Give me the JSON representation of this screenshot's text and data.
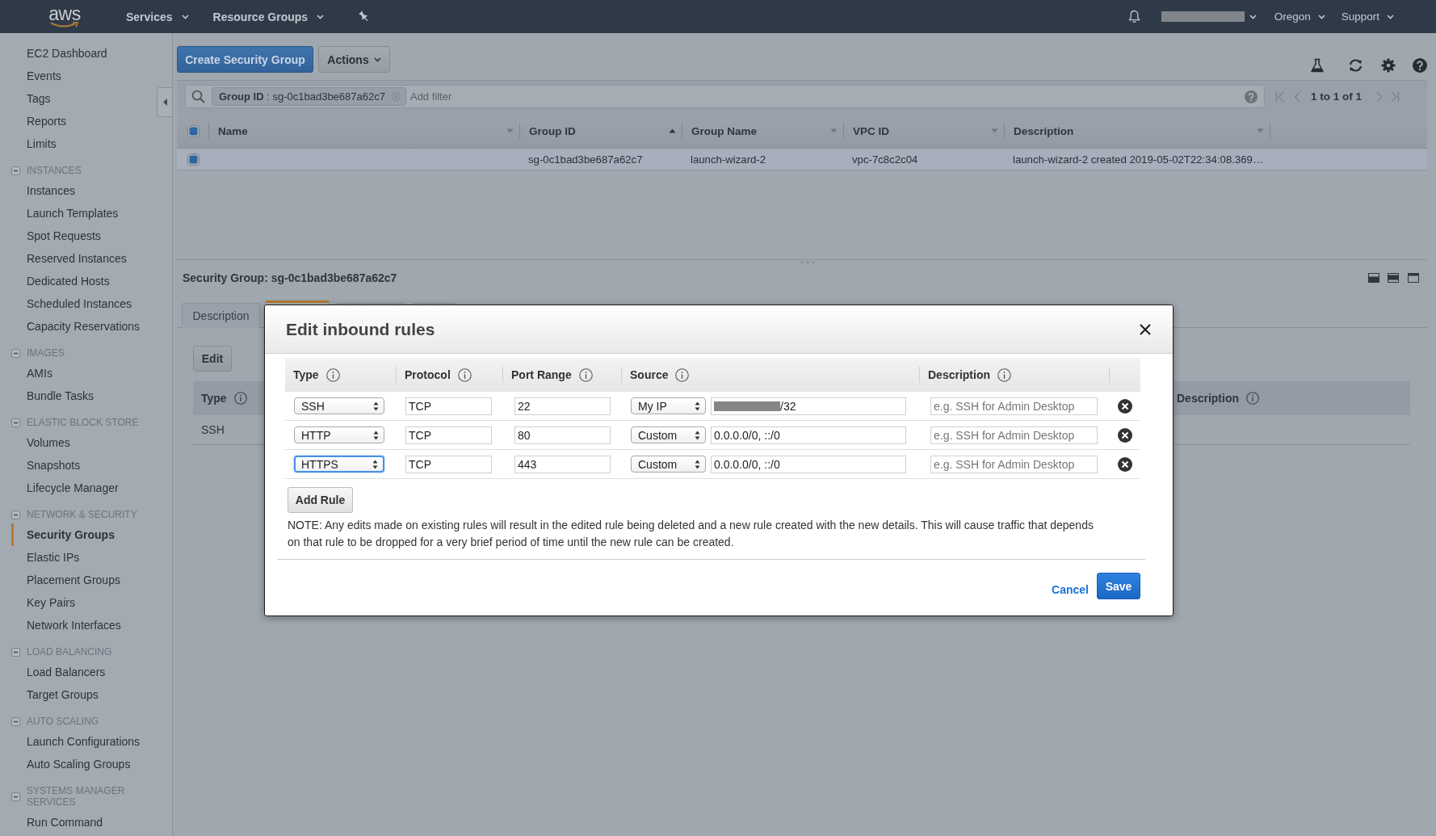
{
  "top_nav": {
    "logo": "aws",
    "menus": [
      {
        "label": "Services"
      },
      {
        "label": "Resource Groups"
      }
    ],
    "account_menu": {
      "redacted": true
    },
    "region_menu": "Oregon",
    "support_menu": "Support"
  },
  "sidebar": {
    "items": [
      {
        "label": "EC2 Dashboard",
        "selected": false
      },
      {
        "label": "Events",
        "selected": false
      },
      {
        "label": "Tags",
        "selected": false
      },
      {
        "label": "Reports",
        "selected": false
      },
      {
        "label": "Limits",
        "selected": false
      }
    ],
    "groups": [
      {
        "title": "INSTANCES",
        "expanded": true,
        "items": [
          {
            "label": "Instances",
            "selected": false
          },
          {
            "label": "Launch Templates",
            "selected": false
          },
          {
            "label": "Spot Requests",
            "selected": false
          },
          {
            "label": "Reserved Instances",
            "selected": false
          },
          {
            "label": "Dedicated Hosts",
            "selected": false
          },
          {
            "label": "Scheduled Instances",
            "selected": false
          },
          {
            "label": "Capacity Reservations",
            "selected": false
          }
        ]
      },
      {
        "title": "IMAGES",
        "expanded": true,
        "items": [
          {
            "label": "AMIs",
            "selected": false
          },
          {
            "label": "Bundle Tasks",
            "selected": false
          }
        ]
      },
      {
        "title": "ELASTIC BLOCK STORE",
        "expanded": true,
        "items": [
          {
            "label": "Volumes",
            "selected": false
          },
          {
            "label": "Snapshots",
            "selected": false
          },
          {
            "label": "Lifecycle Manager",
            "selected": false
          }
        ]
      },
      {
        "title": "NETWORK & SECURITY",
        "expanded": true,
        "items": [
          {
            "label": "Security Groups",
            "selected": true
          },
          {
            "label": "Elastic IPs",
            "selected": false
          },
          {
            "label": "Placement Groups",
            "selected": false
          },
          {
            "label": "Key Pairs",
            "selected": false
          },
          {
            "label": "Network Interfaces",
            "selected": false
          }
        ]
      },
      {
        "title": "LOAD BALANCING",
        "expanded": true,
        "items": [
          {
            "label": "Load Balancers",
            "selected": false
          },
          {
            "label": "Target Groups",
            "selected": false
          }
        ]
      },
      {
        "title": "AUTO SCALING",
        "expanded": true,
        "items": [
          {
            "label": "Launch Configurations",
            "selected": false
          },
          {
            "label": "Auto Scaling Groups",
            "selected": false
          }
        ]
      },
      {
        "title": "SYSTEMS MANAGER SERVICES",
        "expanded": true,
        "items": [
          {
            "label": "Run Command",
            "selected": false
          }
        ]
      }
    ]
  },
  "toolbar": {
    "create_button": "Create Security Group",
    "actions_button": "Actions"
  },
  "filter": {
    "chip": "**Group ID** : sg-0c1bad3be687a62c7",
    "placeholder": "Add filter"
  },
  "pagination": {
    "label": "1 to 1 of 1",
    "disabled": true
  },
  "table": {
    "select_all": {
      "checked": true
    },
    "columns": [
      {
        "label": "Name",
        "sorted": false
      },
      {
        "label": "Group ID",
        "sorted": true
      },
      {
        "label": "Group Name",
        "sorted": false
      },
      {
        "label": "VPC ID",
        "sorted": false
      },
      {
        "label": "Description",
        "sorted": false
      }
    ],
    "rows": [
      {
        "selected": true,
        "group_id": "sg-0c1bad3be687a62c7",
        "group_name": "launch-wizard-2",
        "vpc_id": "vpc-7c8c2c04",
        "description": "launch-wizard-2 created 2019-05-02T22:34:08.369…"
      }
    ]
  },
  "details": {
    "title": "Security Group: sg-0c1bad3be687a62c7",
    "tabs": [
      {
        "label": "Description",
        "selected": false
      },
      {
        "selected": true
      },
      {
        "selected": false
      },
      {
        "selected": false
      }
    ],
    "edit_button": "Edit",
    "columns": [
      {
        "label": "Type"
      },
      {
        "label": "Description"
      }
    ],
    "rows": [
      {
        "type": "SSH"
      }
    ]
  },
  "modal": {
    "title": "Edit inbound rules",
    "columns": [
      {
        "label": "Type"
      },
      {
        "label": "Protocol"
      },
      {
        "label": "Port Range"
      },
      {
        "label": "Source"
      },
      {
        "label": "Description"
      }
    ],
    "rules": [
      {
        "type": "SSH",
        "focused": false,
        "protocol": "TCP",
        "port_range": "22",
        "source": "My IP",
        "redacted": true,
        "source_value": "/32",
        "description_placeholder": "e.g. SSH for Admin Desktop"
      },
      {
        "type": "HTTP",
        "focused": false,
        "protocol": "TCP",
        "port_range": "80",
        "source": "Custom",
        "redacted": false,
        "source_value": "0.0.0.0/0, ::/0",
        "description_placeholder": "e.g. SSH for Admin Desktop"
      },
      {
        "type": "HTTPS",
        "focused": true,
        "protocol": "TCP",
        "port_range": "443",
        "source": "Custom",
        "redacted": false,
        "source_value": "0.0.0.0/0, ::/0",
        "description_placeholder": "e.g. SSH for Admin Desktop"
      }
    ],
    "add_button": "Add Rule",
    "note": "NOTE: Any edits made on existing rules will result in the edited rule being deleted and a new rule created with the new details. This will cause traffic that depends on that rule to be dropped for a very brief period of time until the new rule can be created.",
    "cancel_button": "Cancel",
    "save_button": "Save"
  }
}
